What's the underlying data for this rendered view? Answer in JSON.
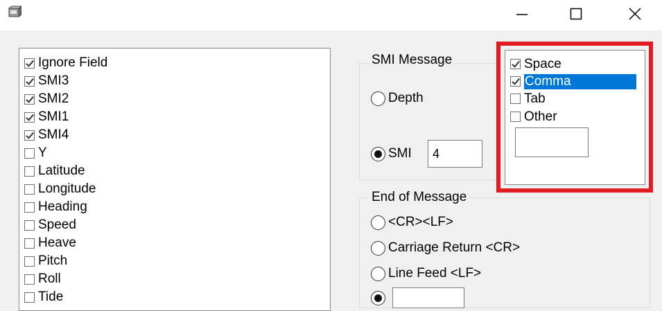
{
  "window": {
    "icon": "application-icon",
    "minimize_icon": "minimize-icon",
    "maximize_icon": "maximize-icon",
    "close_icon": "close-icon"
  },
  "fields": [
    {
      "label": "Ignore Field",
      "checked": true
    },
    {
      "label": "SMI3",
      "checked": true
    },
    {
      "label": "SMI2",
      "checked": true
    },
    {
      "label": "SMI1",
      "checked": true
    },
    {
      "label": "SMI4",
      "checked": true
    },
    {
      "label": "Y",
      "checked": false
    },
    {
      "label": "Latitude",
      "checked": false
    },
    {
      "label": "Longitude",
      "checked": false
    },
    {
      "label": "Heading",
      "checked": false
    },
    {
      "label": "Speed",
      "checked": false
    },
    {
      "label": "Heave",
      "checked": false
    },
    {
      "label": "Pitch",
      "checked": false
    },
    {
      "label": "Roll",
      "checked": false
    },
    {
      "label": "Tide",
      "checked": false
    }
  ],
  "smi_message": {
    "title": "SMI Message",
    "depth_label": "Depth",
    "smi_label": "SMI",
    "smi_value": "4",
    "selected": "SMI"
  },
  "end_of_message": {
    "title": "End of Message",
    "options": [
      "<CR><LF>",
      "Carriage Return <CR>",
      "Line Feed <LF>"
    ],
    "custom_value": ""
  },
  "delimiters": [
    {
      "label": "Space",
      "checked": true,
      "selected": false
    },
    {
      "label": "Comma",
      "checked": true,
      "selected": true
    },
    {
      "label": "Tab",
      "checked": false,
      "selected": false
    },
    {
      "label": "Other",
      "checked": false,
      "selected": false
    }
  ],
  "other_value": "",
  "colors": {
    "highlight": "#e11b22",
    "selection": "#0078d7"
  }
}
